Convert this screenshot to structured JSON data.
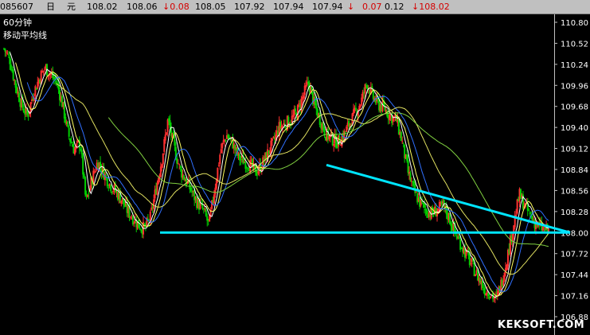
{
  "header": {
    "code": "085607",
    "period_glyph": "日",
    "unit_glyph": "元",
    "open": "108.02",
    "high": "108.06",
    "change": "↓0.08",
    "low": "108.05",
    "v1": "107.92",
    "v2": "107.94",
    "last": "107.94",
    "arrow": "↓",
    "chg2": "0.07",
    "v3": "0.12",
    "final": "↓108.02"
  },
  "overlay": {
    "period_label": "60分钟",
    "indicator_label": "移动平均线"
  },
  "watermark": "KEKSOFT.COM",
  "colors": {
    "background": "#000000",
    "up_candle": "#ff3030",
    "down_candle": "#00d000",
    "trendline": "#00e5ff",
    "ma_short": "#ffffff",
    "ma_mid": "#ffff60",
    "ma_long1": "#3070ff",
    "ma_long2": "#e0e060",
    "ma_longest": "#80d040",
    "axis_text": "#ffffff"
  },
  "chart_data": {
    "type": "candlestick",
    "ylim": [
      106.88,
      110.8
    ],
    "yticks": [
      "110.80",
      "110.52",
      "110.24",
      "109.96",
      "109.68",
      "109.40",
      "109.12",
      "108.84",
      "108.56",
      "108.28",
      "108.00",
      "107.72",
      "107.44",
      "107.16",
      "106.88"
    ],
    "close_path": [
      110.45,
      110.3,
      109.95,
      109.7,
      109.55,
      109.85,
      110.05,
      110.2,
      110.1,
      110.0,
      109.7,
      109.3,
      109.1,
      109.2,
      108.4,
      108.7,
      108.95,
      108.8,
      108.65,
      108.55,
      108.45,
      108.3,
      108.2,
      108.1,
      108.05,
      108.2,
      108.6,
      109.0,
      109.5,
      109.15,
      108.85,
      108.7,
      108.55,
      108.4,
      108.3,
      108.1,
      108.6,
      109.1,
      109.3,
      109.2,
      109.0,
      108.95,
      108.9,
      108.8,
      108.9,
      109.05,
      109.2,
      109.4,
      109.45,
      109.5,
      109.6,
      109.8,
      110.0,
      109.7,
      109.5,
      109.3,
      109.25,
      109.2,
      109.3,
      109.45,
      109.6,
      109.75,
      110.0,
      109.8,
      109.7,
      109.65,
      109.55,
      109.5,
      109.2,
      108.8,
      108.55,
      108.4,
      108.3,
      108.25,
      108.3,
      108.35,
      108.2,
      108.0,
      107.85,
      107.7,
      107.55,
      107.4,
      107.25,
      107.2,
      107.1,
      107.35,
      107.7,
      108.1,
      108.5,
      108.35,
      108.2,
      108.1,
      108.05,
      108.02
    ],
    "series": [],
    "trendlines": [
      {
        "from": [
          201,
          108.0
        ],
        "to": [
          716,
          108.0
        ]
      },
      {
        "from": [
          410,
          108.9
        ],
        "to": [
          716,
          108.0
        ]
      }
    ]
  }
}
